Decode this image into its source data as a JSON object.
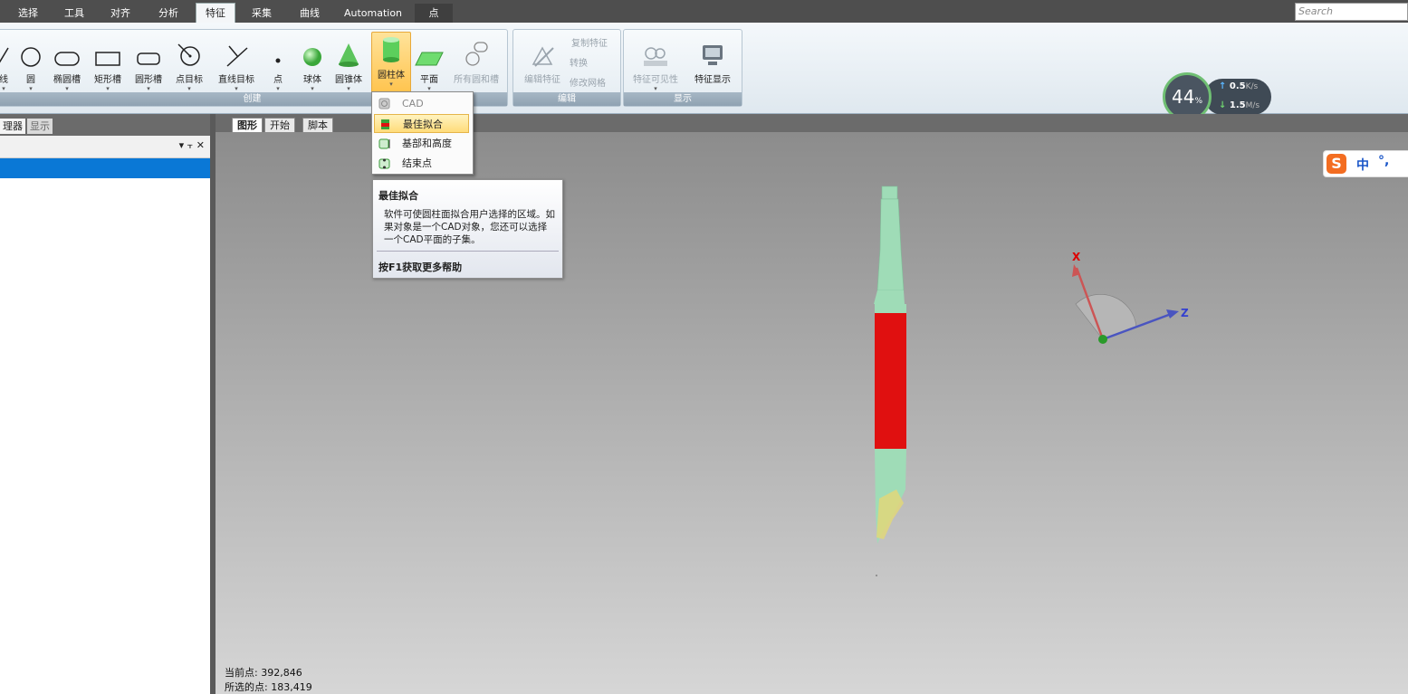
{
  "tabs": {
    "items": [
      {
        "label": "选择"
      },
      {
        "label": "工具"
      },
      {
        "label": "对齐"
      },
      {
        "label": "分析"
      },
      {
        "label": "特征",
        "active": true
      },
      {
        "label": "采集"
      },
      {
        "label": "曲线"
      },
      {
        "label": "Automation"
      },
      {
        "label": "点"
      }
    ]
  },
  "search": {
    "placeholder": "Search"
  },
  "ribbon": {
    "create": {
      "label": "创建",
      "buttons": [
        {
          "label": "线"
        },
        {
          "label": "圆"
        },
        {
          "label": "椭圆槽"
        },
        {
          "label": "矩形槽"
        },
        {
          "label": "圆形槽"
        },
        {
          "label": "点目标"
        },
        {
          "label": "直线目标"
        },
        {
          "label": "点"
        },
        {
          "label": "球体"
        },
        {
          "label": "圆锥体"
        },
        {
          "label": "圆柱体"
        },
        {
          "label": "平面"
        },
        {
          "label": "所有圆和槽"
        }
      ]
    },
    "edit": {
      "label": "编辑",
      "edit_feature": "编辑特征",
      "copy_feature": "复制特征",
      "transform": "转换",
      "modify_mesh": "修改网格"
    },
    "display": {
      "label": "显示",
      "visibility": "特征可见性",
      "show": "特征显示"
    }
  },
  "gauge": {
    "percent": "44",
    "unit": "%",
    "up_value": "0.5",
    "up_unit": "K/s",
    "down_value": "1.5",
    "down_unit": "M/s"
  },
  "left_panel": {
    "tab1": "理器",
    "tab2": "显示",
    "controls": "▾ ⫟ ✕"
  },
  "view_tabs": [
    {
      "label": "图形",
      "active": true
    },
    {
      "label": "开始"
    },
    {
      "label": "脚本"
    }
  ],
  "dropdown": {
    "items": [
      {
        "label": "CAD",
        "disabled": true
      },
      {
        "label": "最佳拟合",
        "highlighted": true
      },
      {
        "label": "基部和高度"
      },
      {
        "label": "结束点"
      }
    ]
  },
  "tooltip": {
    "title": "最佳拟合",
    "body": "软件可使圆柱面拟合用户选择的区域。如果对象是一个CAD对象，您还可以选择一个CAD平面的子集。",
    "footer": "按F1获取更多帮助"
  },
  "status": {
    "current_points": "当前点: 392,846",
    "selected_points": "所选的点: 183,419"
  },
  "axes": {
    "x": "X",
    "z": "Z"
  },
  "ime": {
    "logo": "S",
    "mode": "中",
    "punct": "°,"
  },
  "colors": {
    "accent": "#0a78d6",
    "cylinder_selected": "#e01010",
    "mesh": "#9fdcb7",
    "highlight": "#ffc24a"
  }
}
